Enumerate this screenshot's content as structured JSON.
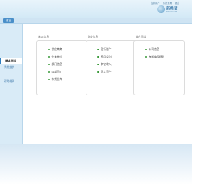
{
  "header": {
    "links": [
      "当前用户",
      "系统设置",
      "退出"
    ],
    "logo_title": "新希望",
    "logo_subtitle": "NEWHOPE"
  },
  "tab": {
    "label": "首页"
  },
  "sidebar": {
    "items": [
      {
        "label": "基本资料",
        "active": true
      },
      {
        "label": "系统维护",
        "active": false
      },
      {
        "label": "帮助说明",
        "active": false
      }
    ]
  },
  "panels": [
    {
      "title": "基本信息",
      "items": [
        "供应商商",
        "往来单位",
        "部门信息",
        "内部员工",
        "存货仓库"
      ]
    },
    {
      "title": "财务信息",
      "items": [
        "银行账户",
        "费用类别",
        "其它收入",
        "固定资产"
      ]
    },
    {
      "title": "其它资料",
      "items": [
        "公司信息",
        "单据编号规则"
      ]
    }
  ],
  "colors": {
    "accent": "#4a8fc9",
    "bullet": "#3a9a3a"
  }
}
